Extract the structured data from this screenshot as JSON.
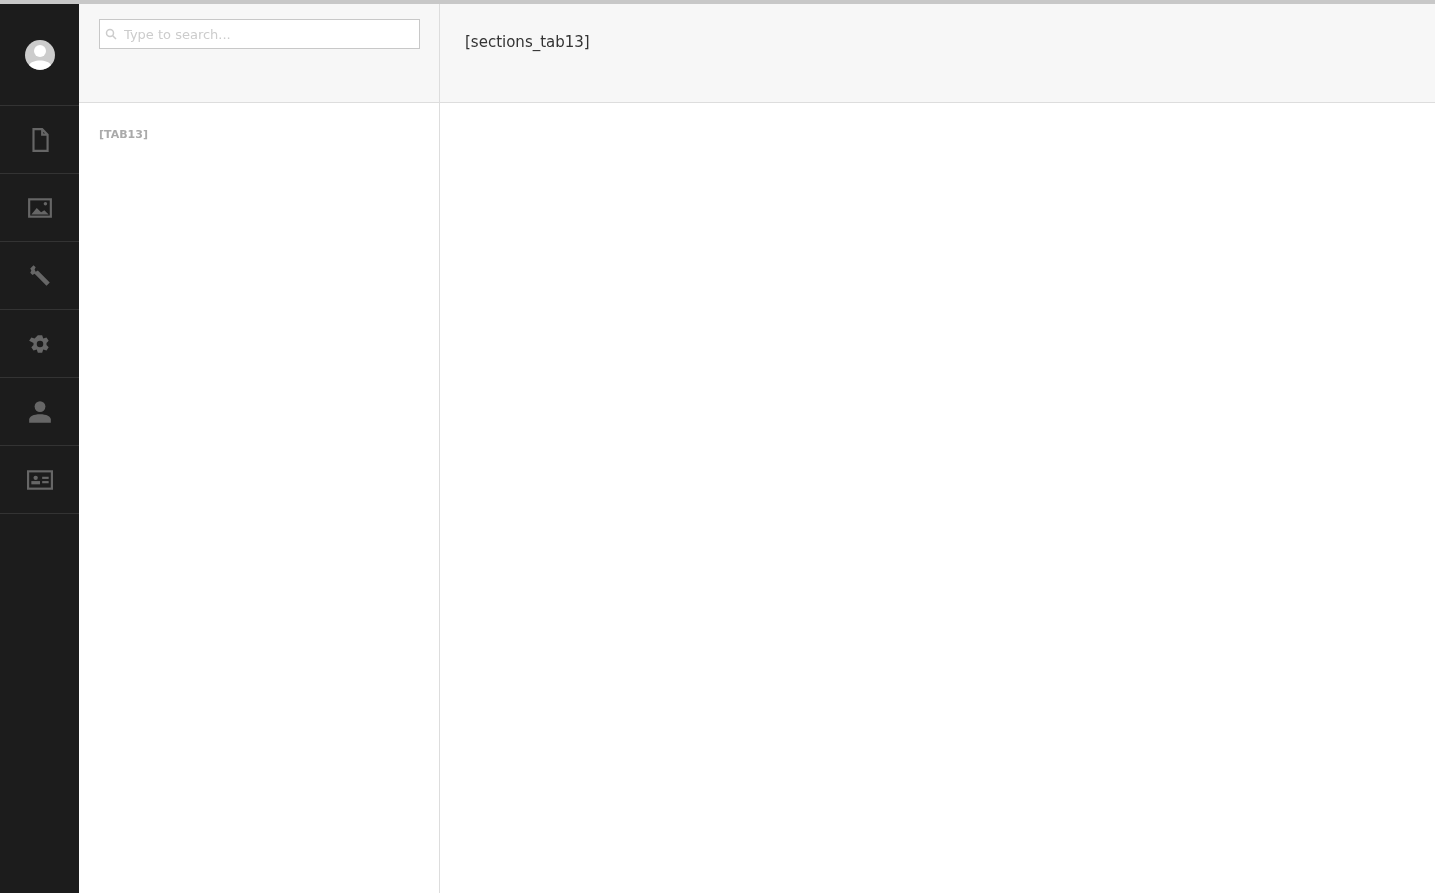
{
  "sidebar": {
    "items": [
      {
        "kind": "document"
      },
      {
        "kind": "image"
      },
      {
        "kind": "wrench"
      },
      {
        "kind": "gear"
      },
      {
        "kind": "person"
      },
      {
        "kind": "card"
      }
    ]
  },
  "search": {
    "placeholder": "Type to search..."
  },
  "list": {
    "heading": "[TAB13]"
  },
  "content": {
    "title": "[sections_tab13]"
  }
}
